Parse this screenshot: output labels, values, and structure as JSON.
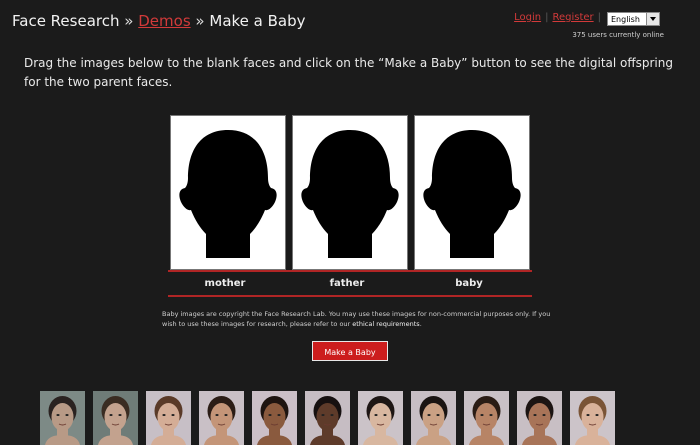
{
  "header": {
    "site": "Face Research",
    "sep1": "»",
    "demos": "Demos",
    "sep2": "»",
    "current": "Make a Baby"
  },
  "account": {
    "login": "Login",
    "register": "Register",
    "language": "English",
    "online": "375 users currently online"
  },
  "intro": "Drag the images below to the blank faces and click on the “Make a Baby” button to see the digital offspring for the two parent faces.",
  "slots": [
    {
      "label": "mother"
    },
    {
      "label": "father"
    },
    {
      "label": "baby"
    }
  ],
  "copyright": {
    "text": "Baby images are copyright the Face Research Lab. You may use these images for non-commercial purposes only. If you wish to use these images for research, please refer to our",
    "link": "ethical requirements",
    "end": "."
  },
  "button": "Make a Baby",
  "colors": {
    "accent": "#cc1d1d",
    "background": "#1b1b1b",
    "link": "#d23a3a"
  },
  "thumbs": [
    {
      "name": "face-1",
      "bg": "#7d8a86",
      "skin": "#b89a86",
      "hair": "#2a2220"
    },
    {
      "name": "face-2",
      "bg": "#6f7c78",
      "skin": "#c3a28e",
      "hair": "#3a2c22"
    },
    {
      "name": "face-3",
      "bg": "#c7bfc6",
      "skin": "#d4ad96",
      "hair": "#5a3a28"
    },
    {
      "name": "face-4",
      "bg": "#c9c0c6",
      "skin": "#c49578",
      "hair": "#2b1d16"
    },
    {
      "name": "face-5",
      "bg": "#cbbfc7",
      "skin": "#8a5a3e",
      "hair": "#1e1410"
    },
    {
      "name": "face-6",
      "bg": "#c6bdc3",
      "skin": "#5e3b2a",
      "hair": "#161010"
    },
    {
      "name": "face-7",
      "bg": "#cbc3c8",
      "skin": "#d8b7a0",
      "hair": "#1d1614"
    },
    {
      "name": "face-8",
      "bg": "#c7bec4",
      "skin": "#caa184",
      "hair": "#1a1412"
    },
    {
      "name": "face-9",
      "bg": "#c9c1c6",
      "skin": "#b78466",
      "hair": "#2a1c14"
    },
    {
      "name": "face-10",
      "bg": "#c8bfc4",
      "skin": "#a87458",
      "hair": "#1b1412"
    },
    {
      "name": "face-11",
      "bg": "#ccc4c9",
      "skin": "#d9b29a",
      "hair": "#7a5436"
    }
  ]
}
